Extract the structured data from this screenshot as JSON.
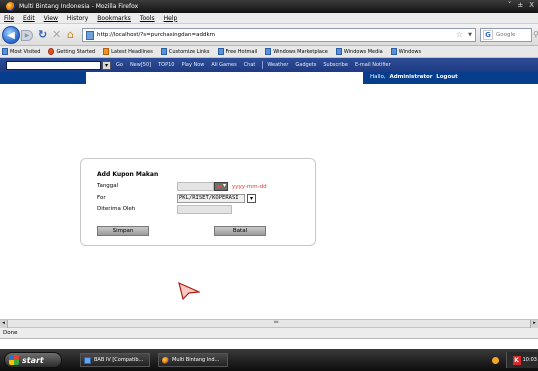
{
  "window": {
    "title": "Multi Bintang Indonesia - Mozilla Firefox",
    "controls": [
      "˅",
      "±",
      "X"
    ]
  },
  "menu": {
    "items": [
      "File",
      "Edit",
      "View",
      "History",
      "Bookmarks",
      "Tools",
      "Help"
    ]
  },
  "nav": {
    "url": "http://localhost/?s=purchasingdan=addkm",
    "search_engine": "Google",
    "search_placeholder": "Google"
  },
  "bookmarks": {
    "items": [
      "Most Visited",
      "Getting Started",
      "Latest Headlines",
      "Customize Links",
      "Free Hotmail",
      "Windows Marketplace",
      "Windows Media",
      "Windows"
    ]
  },
  "addon_toolbar": {
    "items": [
      "Go",
      "New[50]",
      "TOP10",
      "Play Now",
      "All Games",
      "Chat",
      "Weather",
      "Gadgets",
      "Subscribe",
      "E-mail Notifier"
    ]
  },
  "header": {
    "greeting": "Hallo,",
    "user": "Administrator",
    "logout": "Logout"
  },
  "form": {
    "title": "Add Kupon Makan",
    "labels": {
      "tanggal": "Tanggal",
      "for": "For",
      "diterima": "Diterima Oleh"
    },
    "date_hint": "yyyy-mm-dd",
    "for_value": "PKL/RISET/KOPERASI",
    "for_button": "▾",
    "save_label": "Simpan",
    "cancel_label": "Batal"
  },
  "status": {
    "text": "Done"
  },
  "taskbar": {
    "start_label": "start",
    "tasks": [
      "BAB IV [Compatib...",
      "Multi Bintang Ind..."
    ],
    "clock": "10:03"
  },
  "colors": {
    "header_blue": "#063d8c",
    "hint_red": "#e2362b",
    "addon_blue": "#1e3a82"
  }
}
